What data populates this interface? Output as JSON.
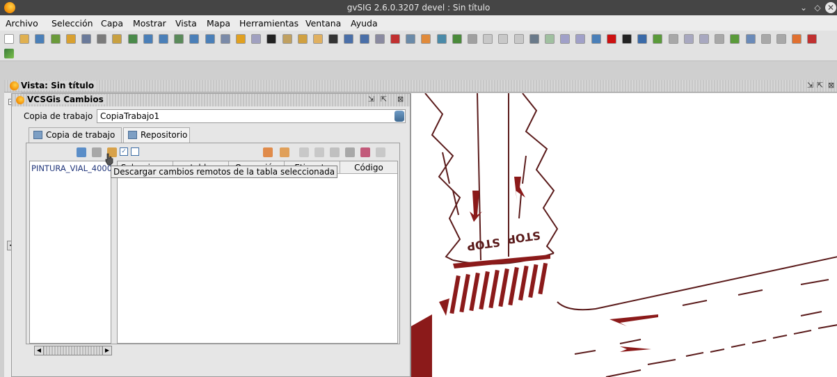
{
  "window": {
    "title": "gvSIG 2.6.0.3207 devel : Sin título"
  },
  "menu": [
    "Archivo",
    "Selección",
    "Capa",
    "Mostrar",
    "Vista",
    "Mapa",
    "Herramientas",
    "Ventana",
    "Ayuda"
  ],
  "vista": {
    "title": "Vista: Sin título"
  },
  "vcs": {
    "title": "VCSGis Cambios",
    "copia_label": "Copia de trabajo",
    "copia_value": "CopiaTrabajo1",
    "tabs": [
      "Copia de trabajo",
      "Repositorio"
    ],
    "list_item": "PINTURA_VIAL_4000",
    "columns": [
      "Seleccionar",
      "tabla",
      "Operación",
      "Etiqueta",
      "Código"
    ],
    "tooltip": "Descargar cambios remotos de la tabla seleccionada"
  },
  "map": {
    "labels": [
      "STOP",
      "STOP"
    ],
    "accent": "#8b1a1a"
  }
}
